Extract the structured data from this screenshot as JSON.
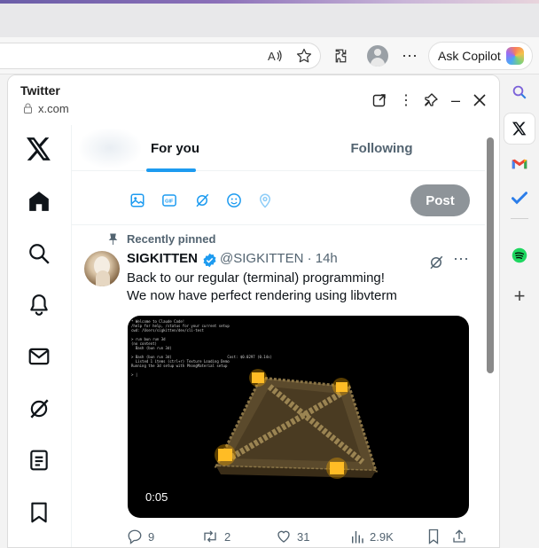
{
  "browser": {
    "copilot_label": "Ask Copilot"
  },
  "panel": {
    "title": "Twitter",
    "url": "x.com"
  },
  "feed": {
    "tabs": [
      "For you",
      "Following"
    ],
    "post_label": "Post"
  },
  "tweet": {
    "pinned_label": "Recently pinned",
    "author_name": "SIGKITTEN",
    "handle_time": "@SIGKITTEN · 14h",
    "text_line1": "Back to our regular (terminal) programming!",
    "text_line2": "We now have perfect rendering using libvterm",
    "video_duration": "0:05",
    "replies": "9",
    "reposts": "2",
    "likes": "31",
    "views": "2.9K"
  },
  "colors": {
    "accent": "#1d9bf0",
    "post_disabled": "#8e9499",
    "muted_text": "#536471"
  }
}
